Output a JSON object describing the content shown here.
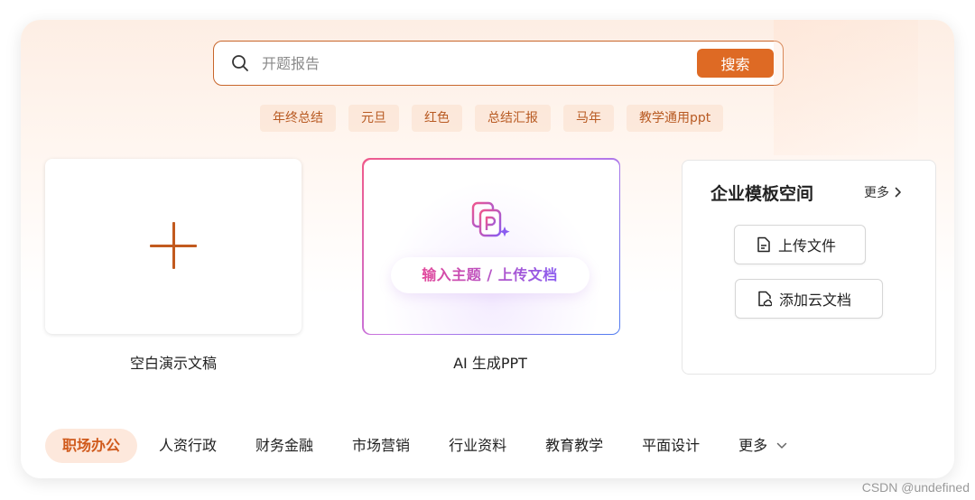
{
  "search": {
    "placeholder": "开题报告",
    "button_label": "搜索"
  },
  "chips": [
    "年终总结",
    "元旦",
    "红色",
    "总结汇报",
    "马年",
    "教学通用ppt"
  ],
  "cards": {
    "blank_label": "空白演示文稿",
    "ai_label": "AI 生成PPT",
    "ai_prompt": "输入主题 / 上传文档"
  },
  "enterprise": {
    "title": "企业模板空间",
    "more": "更多",
    "upload_label": "上传文件",
    "cloud_label": "添加云文档"
  },
  "categories": {
    "items": [
      "职场办公",
      "人资行政",
      "财务金融",
      "市场营销",
      "行业资料",
      "教育教学",
      "平面设计"
    ],
    "active_index": 0,
    "more": "更多"
  },
  "watermark": "CSDN @undefined",
  "colors": {
    "accent": "#de6a24",
    "chip_text": "#b85a22",
    "active_bg": "#fde8dc"
  }
}
